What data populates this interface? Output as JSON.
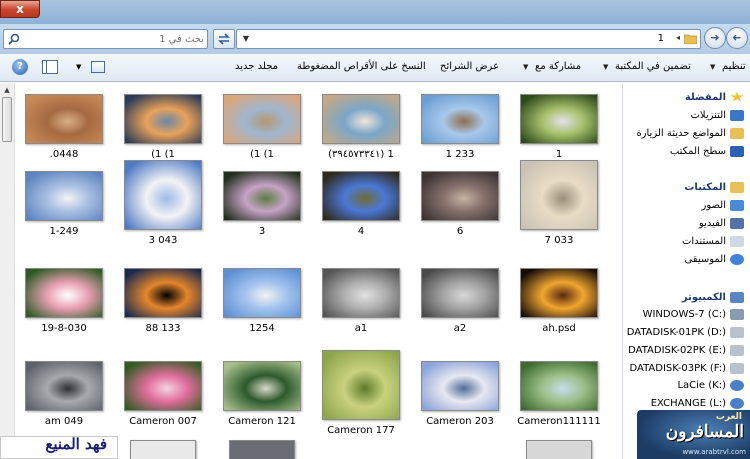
{
  "window": {
    "close_label": "x"
  },
  "address": {
    "path": "1",
    "search_placeholder": "بحث في 1"
  },
  "toolbar": {
    "organize": "تنظيم",
    "include": "تضمين في المكتبة",
    "share": "مشاركة مع",
    "slideshow": "عرض الشرائح",
    "burn": "النسخ على الأقراص المضغوطة",
    "new_folder": "مجلد جديد",
    "help": "?"
  },
  "files": [
    {
      "label": "1",
      "colors": [
        "#2e4a1c",
        "#a6c06a",
        "#e6e2ec"
      ]
    },
    {
      "label": "1 233",
      "colors": [
        "#6c9fd4",
        "#a9c8ea",
        "#8c6e4e"
      ]
    },
    {
      "label": "(٣٩٤٥٧٣٣٤١) 1",
      "colors": [
        "#c2a989",
        "#7aa6c9",
        "#f0e5d8"
      ]
    },
    {
      "label": "(1 (1",
      "colors": [
        "#dba57a",
        "#9fb6cf",
        "#b59872"
      ]
    },
    {
      "label": "(1 (1",
      "colors": [
        "#2d3b57",
        "#e8a25a",
        "#6b87a8"
      ]
    },
    {
      "label": ".0448",
      "colors": [
        "#c88a58",
        "#a56a42",
        "#d9b087"
      ]
    },
    {
      "label": "7 033",
      "colors": [
        "#c9c2b4",
        "#e9dcc6",
        "#9a8e7b"
      ]
    },
    {
      "label": "6",
      "colors": [
        "#3c3333",
        "#86716d",
        "#c9b3a4"
      ]
    },
    {
      "label": "4",
      "colors": [
        "#2f2a1d",
        "#4a78d6",
        "#6f6c35"
      ]
    },
    {
      "label": "3",
      "colors": [
        "#21301c",
        "#c6a3c7",
        "#5d7d44"
      ]
    },
    {
      "label": "3 043",
      "colors": [
        "#4f7bc4",
        "#f3f3f5",
        "#9dbbe6"
      ]
    },
    {
      "label": "1-249",
      "colors": [
        "#5d83c0",
        "#a9c0e2",
        "#f4f4f4"
      ]
    },
    {
      "label": "ah.psd",
      "colors": [
        "#170c08",
        "#f0a630",
        "#5a2a12"
      ]
    },
    {
      "label": "a2",
      "colors": [
        "#4a4a4a",
        "#a5a5a5",
        "#d8d8d8"
      ]
    },
    {
      "label": "a1",
      "colors": [
        "#555555",
        "#b0b0b0",
        "#e2e2e2"
      ]
    },
    {
      "label": "1254",
      "colors": [
        "#5d8fd6",
        "#a4c4ee",
        "#f2f2f2"
      ]
    },
    {
      "label": "88 133",
      "colors": [
        "#1c2a4e",
        "#e4862c",
        "#000000"
      ]
    },
    {
      "label": "19-8-030",
      "colors": [
        "#2d5a24",
        "#e8a0b3",
        "#ffffff"
      ]
    },
    {
      "label": "Cameron111111",
      "colors": [
        "#3f6b2f",
        "#9dc18a",
        "#c7dcee"
      ]
    },
    {
      "label": "Cameron 203",
      "colors": [
        "#8aa3d8",
        "#e8e8f0",
        "#4d6d9a"
      ]
    },
    {
      "label": "Cameron 177",
      "colors": [
        "#8ea54a",
        "#c8d27e",
        "#5d7a2a"
      ]
    },
    {
      "label": "Cameron 121",
      "colors": [
        "#a8bf8c",
        "#2d5a2d",
        "#d8d9c8"
      ]
    },
    {
      "label": "Cameron 007",
      "colors": [
        "#345a22",
        "#e06e9c",
        "#f5d3e1"
      ]
    },
    {
      "label": "am 049",
      "colors": [
        "#5d6168",
        "#a6a9ad",
        "#2e3136"
      ]
    }
  ],
  "nav": {
    "favorites": "المفضلة",
    "downloads": "التنزيلات",
    "recent": "المواضع حديثة الزيارة",
    "desktop": "سطح المكتب",
    "libraries": "المكتبات",
    "pictures": "الصور",
    "videos": "الفيديو",
    "documents": "المستندات",
    "music": "الموسيقى",
    "computer": "الكمبيوتر",
    "drive_c": "WINDOWS-7 (C:)",
    "drive_d": "DATADISK-01PK (D:)",
    "drive_e": "DATADISK-02PK (E:)",
    "drive_f": "DATADISK-03PK (F:)",
    "drive_k": "LaCie (K:)",
    "drive_l": "EXCHANGE (L:)"
  },
  "watermark_left": {
    "text": "فهد المنيع"
  },
  "watermark_right": {
    "top": "العرب",
    "name": "المسافرون",
    "url": "www.arabtrvl.com"
  }
}
